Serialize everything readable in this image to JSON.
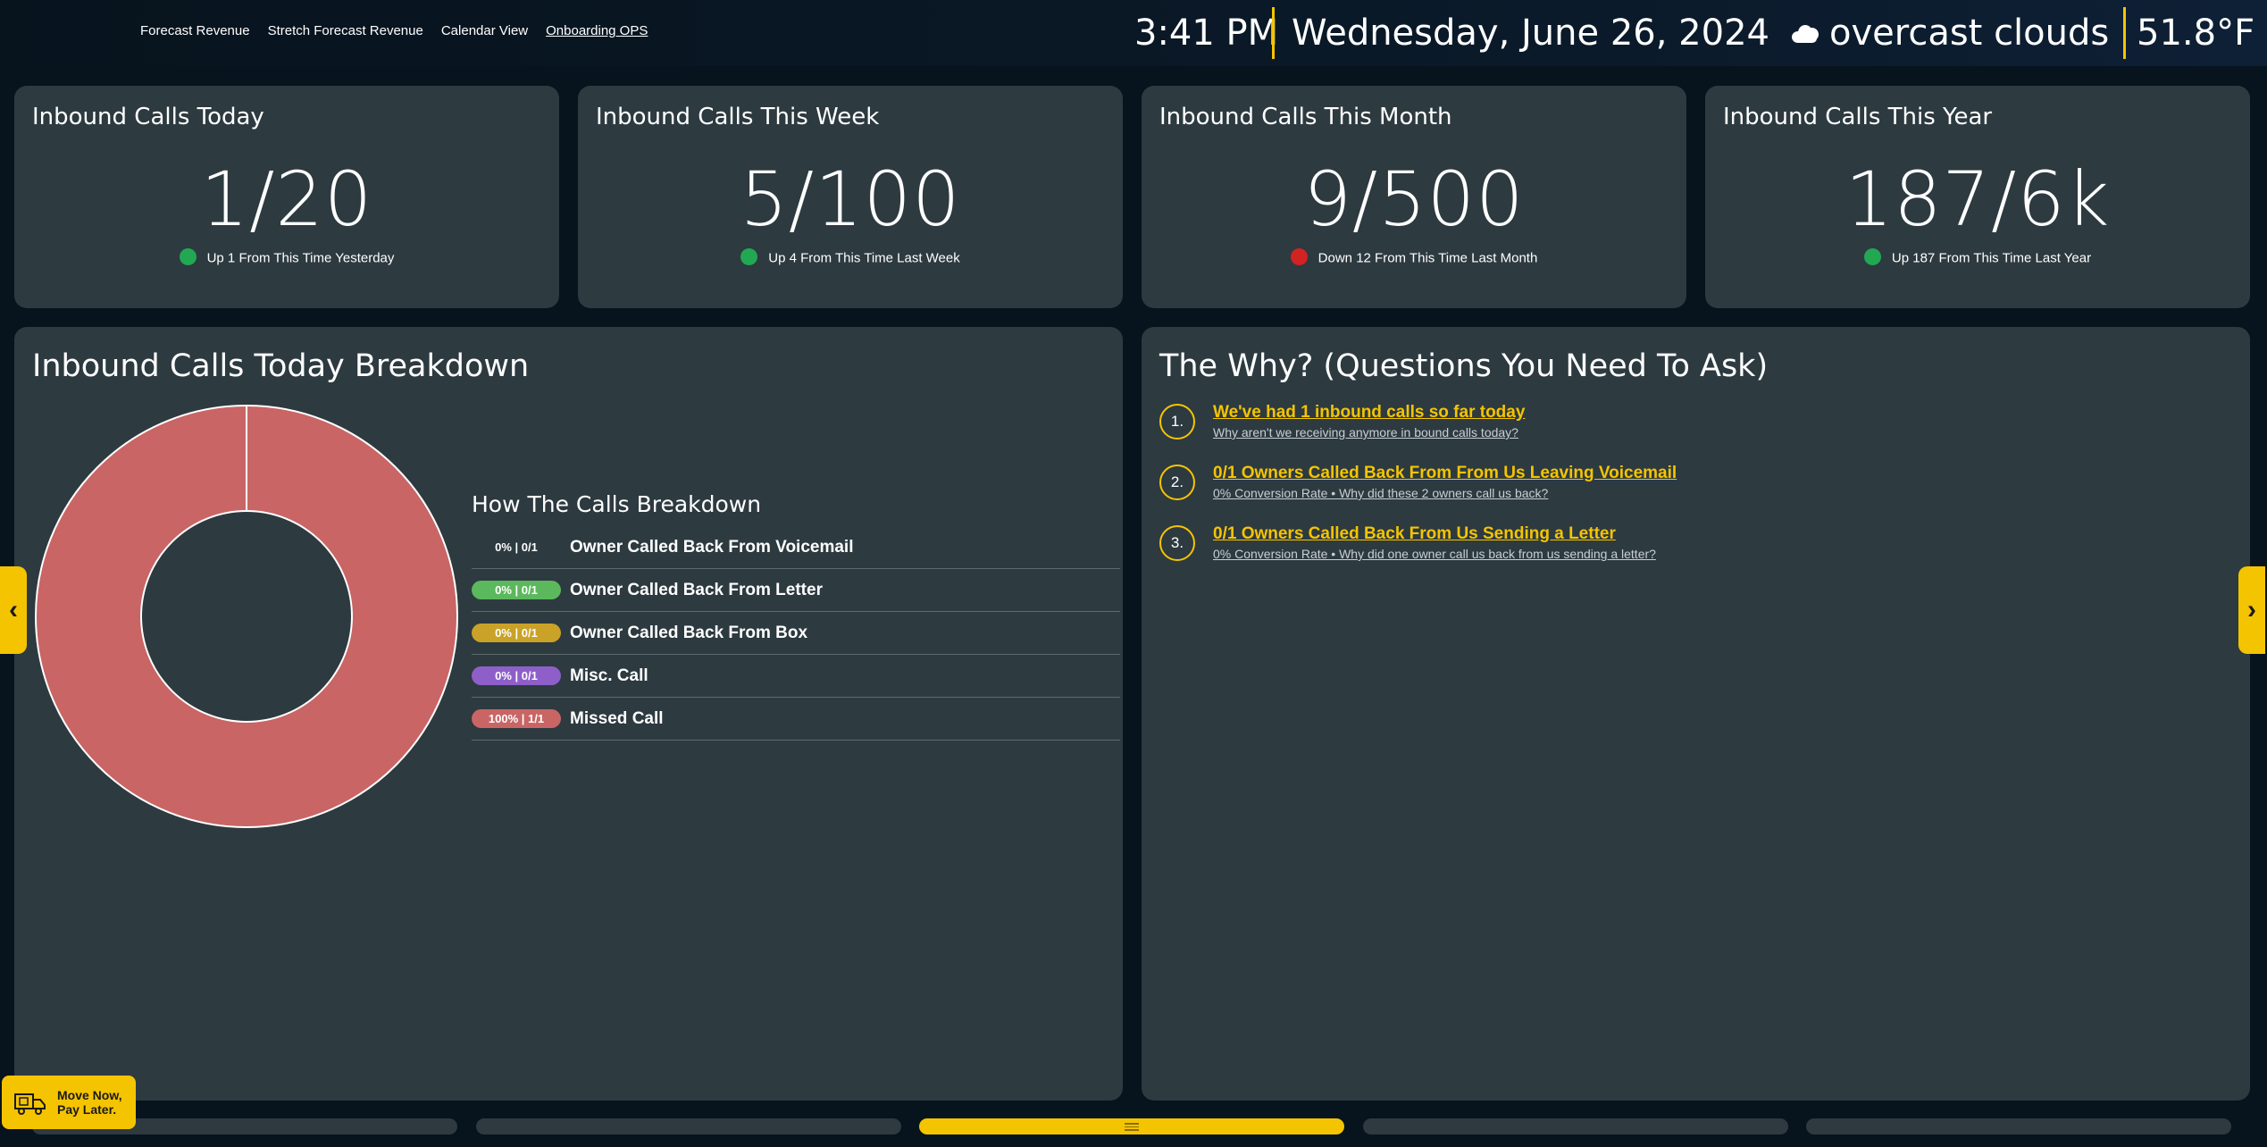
{
  "nav": {
    "items": [
      "Forecast Revenue",
      "Stretch Forecast Revenue",
      "Calendar View",
      "Onboarding OPS"
    ],
    "active_index": 3
  },
  "header": {
    "time": "3:41 PM",
    "date": "Wednesday, June 26, 2024",
    "weather": "overcast clouds",
    "weather_icon": "cloud-icon",
    "temperature": "51.8°F",
    "divider_color": "#f5c400"
  },
  "stats": [
    {
      "title": "Inbound Calls Today",
      "value": "1/20",
      "delta": "Up 1 From This Time Yesterday",
      "status": "up",
      "dot_color": "#22a853"
    },
    {
      "title": "Inbound Calls This Week",
      "value": "5/100",
      "delta": "Up 4 From This Time Last Week",
      "status": "up",
      "dot_color": "#22a853"
    },
    {
      "title": "Inbound Calls This Month",
      "value": "9/500",
      "delta": "Down 12 From This Time Last Month",
      "status": "down",
      "dot_color": "#d32222"
    },
    {
      "title": "Inbound Calls This Year",
      "value": "187/6k",
      "delta": "Up 187 From This Time Last Year",
      "status": "up",
      "dot_color": "#22a853"
    }
  ],
  "breakdown": {
    "title": "Inbound Calls Today Breakdown",
    "legend_title": "How The Calls Breakdown",
    "rows": [
      {
        "pill": "0% | 0/1",
        "label": "Owner Called Back From Voicemail",
        "color": "#2d3a40"
      },
      {
        "pill": "0% | 0/1",
        "label": "Owner Called Back From Letter",
        "color": "#5cb85c"
      },
      {
        "pill": "0% | 0/1",
        "label": "Owner Called Back From Box",
        "color": "#c9a227"
      },
      {
        "pill": "0% | 0/1",
        "label": "Misc. Call",
        "color": "#8e5fc9"
      },
      {
        "pill": "100% | 1/1",
        "label": "Missed Call",
        "color": "#c96565"
      }
    ]
  },
  "chart_data": {
    "type": "pie",
    "donut": true,
    "categories": [
      "Owner Called Back From Voicemail",
      "Owner Called Back From Letter",
      "Owner Called Back From Box",
      "Misc. Call",
      "Missed Call"
    ],
    "values": [
      0,
      0,
      0,
      0,
      1
    ],
    "colors": [
      "#2d3a40",
      "#5cb85c",
      "#c9a227",
      "#8e5fc9",
      "#c96565"
    ]
  },
  "why": {
    "title": "The Why? (Questions You Need To Ask)",
    "items": [
      {
        "num": "1.",
        "head": "We've had 1 inbound calls so far today",
        "sub": "Why aren't we receiving anymore in bound calls today?"
      },
      {
        "num": "2.",
        "head": "0/1 Owners Called Back From From Us Leaving Voicemail",
        "sub": "0% Conversion Rate • Why did these 2 owners call us back?"
      },
      {
        "num": "3.",
        "head": "0/1 Owners Called Back From Us Sending a Letter",
        "sub": "0% Conversion Rate • Why did one owner call us back from us sending a letter?"
      }
    ]
  },
  "arrows": {
    "left": "‹",
    "right": "›"
  },
  "pager": {
    "count": 5,
    "active_index": 2
  },
  "promo": {
    "line1": "Move Now,",
    "line2": "Pay Later.",
    "icon": "moving-truck-icon"
  },
  "colors": {
    "accent": "#f5c400",
    "card": "#2d3a40",
    "background": "#07131d"
  }
}
